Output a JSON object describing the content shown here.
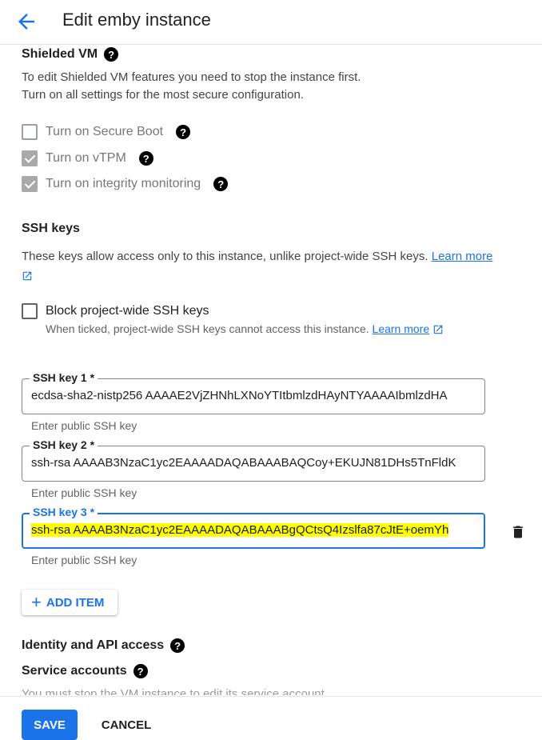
{
  "header": {
    "title": "Edit emby instance",
    "back_icon": "arrow-left-icon"
  },
  "shielded_vm": {
    "title": "Shielded VM",
    "desc1": "To edit Shielded VM features you need to stop the instance first.",
    "desc2": "Turn on all settings for the most secure configuration.",
    "options": [
      {
        "label": "Turn on Secure Boot",
        "checked": false
      },
      {
        "label": "Turn on vTPM",
        "checked": true
      },
      {
        "label": "Turn on integrity monitoring",
        "checked": true
      }
    ]
  },
  "ssh": {
    "title": "SSH keys",
    "desc": "These keys allow access only to this instance, unlike project-wide SSH keys.",
    "learn_more": "Learn more",
    "block_label": "Block project-wide SSH keys",
    "block_desc": "When ticked, project-wide SSH keys cannot access this instance.",
    "block_learn_more": "Learn more",
    "keys": [
      {
        "label": "SSH key 1 *",
        "value": "ecdsa-sha2-nistp256 AAAAE2VjZHNhLXNoYTItbmlzdHAyNTYAAAAIbmlzdHA",
        "hint": "Enter public SSH key"
      },
      {
        "label": "SSH key 2 *",
        "value": "ssh-rsa AAAAB3NzaC1yc2EAAAADAQABAAABAQCoy+EKUJN81DHs5TnFldK",
        "hint": "Enter public SSH key"
      },
      {
        "label": "SSH key 3 *",
        "value": "ssh-rsa AAAAB3NzaC1yc2EAAAADAQABAAABgQCtsQ4Izslfa87cJtE+oemYh",
        "hint": "Enter public SSH key"
      }
    ],
    "add_item": "ADD ITEM"
  },
  "identity": {
    "title": "Identity and API access",
    "service_accounts": "Service accounts",
    "faded_text": "You must stop the VM instance to edit its service account"
  },
  "footer": {
    "save": "SAVE",
    "cancel": "CANCEL"
  },
  "colors": {
    "accent": "#1a73e8",
    "highlight": "#ffff00"
  }
}
